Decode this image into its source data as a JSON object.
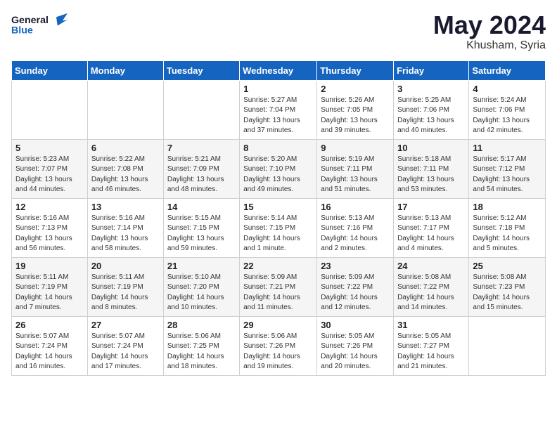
{
  "header": {
    "logo_general": "General",
    "logo_blue": "Blue",
    "month_year": "May 2024",
    "location": "Khusham, Syria"
  },
  "weekdays": [
    "Sunday",
    "Monday",
    "Tuesday",
    "Wednesday",
    "Thursday",
    "Friday",
    "Saturday"
  ],
  "weeks": [
    [
      {
        "day": "",
        "info": ""
      },
      {
        "day": "",
        "info": ""
      },
      {
        "day": "",
        "info": ""
      },
      {
        "day": "1",
        "info": "Sunrise: 5:27 AM\nSunset: 7:04 PM\nDaylight: 13 hours and 37 minutes."
      },
      {
        "day": "2",
        "info": "Sunrise: 5:26 AM\nSunset: 7:05 PM\nDaylight: 13 hours and 39 minutes."
      },
      {
        "day": "3",
        "info": "Sunrise: 5:25 AM\nSunset: 7:06 PM\nDaylight: 13 hours and 40 minutes."
      },
      {
        "day": "4",
        "info": "Sunrise: 5:24 AM\nSunset: 7:06 PM\nDaylight: 13 hours and 42 minutes."
      }
    ],
    [
      {
        "day": "5",
        "info": "Sunrise: 5:23 AM\nSunset: 7:07 PM\nDaylight: 13 hours and 44 minutes."
      },
      {
        "day": "6",
        "info": "Sunrise: 5:22 AM\nSunset: 7:08 PM\nDaylight: 13 hours and 46 minutes."
      },
      {
        "day": "7",
        "info": "Sunrise: 5:21 AM\nSunset: 7:09 PM\nDaylight: 13 hours and 48 minutes."
      },
      {
        "day": "8",
        "info": "Sunrise: 5:20 AM\nSunset: 7:10 PM\nDaylight: 13 hours and 49 minutes."
      },
      {
        "day": "9",
        "info": "Sunrise: 5:19 AM\nSunset: 7:11 PM\nDaylight: 13 hours and 51 minutes."
      },
      {
        "day": "10",
        "info": "Sunrise: 5:18 AM\nSunset: 7:11 PM\nDaylight: 13 hours and 53 minutes."
      },
      {
        "day": "11",
        "info": "Sunrise: 5:17 AM\nSunset: 7:12 PM\nDaylight: 13 hours and 54 minutes."
      }
    ],
    [
      {
        "day": "12",
        "info": "Sunrise: 5:16 AM\nSunset: 7:13 PM\nDaylight: 13 hours and 56 minutes."
      },
      {
        "day": "13",
        "info": "Sunrise: 5:16 AM\nSunset: 7:14 PM\nDaylight: 13 hours and 58 minutes."
      },
      {
        "day": "14",
        "info": "Sunrise: 5:15 AM\nSunset: 7:15 PM\nDaylight: 13 hours and 59 minutes."
      },
      {
        "day": "15",
        "info": "Sunrise: 5:14 AM\nSunset: 7:15 PM\nDaylight: 14 hours and 1 minute."
      },
      {
        "day": "16",
        "info": "Sunrise: 5:13 AM\nSunset: 7:16 PM\nDaylight: 14 hours and 2 minutes."
      },
      {
        "day": "17",
        "info": "Sunrise: 5:13 AM\nSunset: 7:17 PM\nDaylight: 14 hours and 4 minutes."
      },
      {
        "day": "18",
        "info": "Sunrise: 5:12 AM\nSunset: 7:18 PM\nDaylight: 14 hours and 5 minutes."
      }
    ],
    [
      {
        "day": "19",
        "info": "Sunrise: 5:11 AM\nSunset: 7:19 PM\nDaylight: 14 hours and 7 minutes."
      },
      {
        "day": "20",
        "info": "Sunrise: 5:11 AM\nSunset: 7:19 PM\nDaylight: 14 hours and 8 minutes."
      },
      {
        "day": "21",
        "info": "Sunrise: 5:10 AM\nSunset: 7:20 PM\nDaylight: 14 hours and 10 minutes."
      },
      {
        "day": "22",
        "info": "Sunrise: 5:09 AM\nSunset: 7:21 PM\nDaylight: 14 hours and 11 minutes."
      },
      {
        "day": "23",
        "info": "Sunrise: 5:09 AM\nSunset: 7:22 PM\nDaylight: 14 hours and 12 minutes."
      },
      {
        "day": "24",
        "info": "Sunrise: 5:08 AM\nSunset: 7:22 PM\nDaylight: 14 hours and 14 minutes."
      },
      {
        "day": "25",
        "info": "Sunrise: 5:08 AM\nSunset: 7:23 PM\nDaylight: 14 hours and 15 minutes."
      }
    ],
    [
      {
        "day": "26",
        "info": "Sunrise: 5:07 AM\nSunset: 7:24 PM\nDaylight: 14 hours and 16 minutes."
      },
      {
        "day": "27",
        "info": "Sunrise: 5:07 AM\nSunset: 7:24 PM\nDaylight: 14 hours and 17 minutes."
      },
      {
        "day": "28",
        "info": "Sunrise: 5:06 AM\nSunset: 7:25 PM\nDaylight: 14 hours and 18 minutes."
      },
      {
        "day": "29",
        "info": "Sunrise: 5:06 AM\nSunset: 7:26 PM\nDaylight: 14 hours and 19 minutes."
      },
      {
        "day": "30",
        "info": "Sunrise: 5:05 AM\nSunset: 7:26 PM\nDaylight: 14 hours and 20 minutes."
      },
      {
        "day": "31",
        "info": "Sunrise: 5:05 AM\nSunset: 7:27 PM\nDaylight: 14 hours and 21 minutes."
      },
      {
        "day": "",
        "info": ""
      }
    ]
  ]
}
